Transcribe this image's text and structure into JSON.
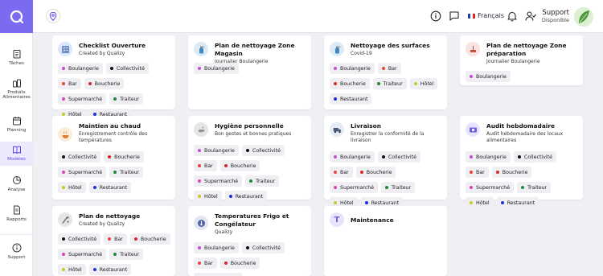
{
  "colors": {
    "accent": "#7b6bf0",
    "active_bg": "#ece9fd"
  },
  "tag_colors": {
    "Boulangerie": "#c84bd8",
    "Collectivité": "#111111",
    "Bar": "#e8453c",
    "Boucherie": "#d62828",
    "Supermarché": "#d944b8",
    "Traiteur": "#1b8a3a",
    "Hôtel": "#c7c92c",
    "Restaurant": "#1d2fd6"
  },
  "sidebar": {
    "items": [
      {
        "label": "Tâches",
        "icon": "clipboard-list-icon"
      },
      {
        "label": "Produits Alimentaires",
        "icon": "bottles-icon"
      },
      {
        "label": "Planning",
        "icon": "calendar-icon"
      },
      {
        "label": "Modèles",
        "icon": "book-icon"
      },
      {
        "label": "Analyse",
        "icon": "pie-chart-icon"
      },
      {
        "label": "Rapports",
        "icon": "document-icon"
      },
      {
        "label": "Support",
        "icon": "info-icon"
      }
    ]
  },
  "header": {
    "language": "Français",
    "support_name": "Support",
    "support_status": "Disponible"
  },
  "cards": [
    {
      "title": "Checklist Ouverture",
      "subtitle": "Created by Qualizy",
      "icon": "checklist-icon",
      "icon_bg": "#dbe7f6",
      "tags": [
        "Boulangerie",
        "Collectivité",
        "Bar",
        "Boucherie",
        "Supermarché",
        "Traiteur",
        "Hôtel",
        "Restaurant"
      ]
    },
    {
      "title": "Plan de nettoyage Zone Magasin",
      "subtitle": "Journalier Boulangerie",
      "icon": "spray-bottle-icon",
      "icon_bg": "#dbeaf5",
      "tags": [
        "Boulangerie"
      ]
    },
    {
      "title": "Nettoyage des surfaces",
      "subtitle": "Covid-19",
      "icon": "spray-bottle-icon",
      "icon_bg": "#dbeaf5",
      "tags": [
        "Boulangerie",
        "Bar",
        "Boucherie",
        "Traiteur",
        "Hôtel",
        "Restaurant"
      ]
    },
    {
      "title": "Plan de nettoyage Zone préparation",
      "subtitle": "Journalier Boulangerie",
      "icon": "cleaning-icon",
      "icon_bg": "#fbe3e3",
      "tags": [
        "Boulangerie"
      ]
    },
    {
      "title": "Maintien au chaud",
      "subtitle": "Enregistrement contrôle des températures",
      "icon": "hot-dish-icon",
      "icon_bg": "#fdecd9",
      "tags": [
        "Collectivité",
        "Boucherie",
        "Supermarché",
        "Traiteur",
        "Hôtel",
        "Restaurant"
      ]
    },
    {
      "title": "Hygiène personnelle",
      "subtitle": "Bon gestes et bonnes pratiques",
      "icon": "hand-wash-icon",
      "icon_bg": "#e6e6e6",
      "tags": [
        "Boulangerie",
        "Collectivité",
        "Bar",
        "Boucherie",
        "Supermarché",
        "Traiteur",
        "Hôtel",
        "Restaurant"
      ]
    },
    {
      "title": "Livraison",
      "subtitle": "Enregistrer la conformité de la livraison",
      "icon": "truck-icon",
      "icon_bg": "#e6ecf5",
      "tags": [
        "Boulangerie",
        "Collectivité",
        "Bar",
        "Boucherie",
        "Supermarché",
        "Traiteur",
        "Hôtel",
        "Restaurant"
      ]
    },
    {
      "title": "Audit hebdomadaire",
      "subtitle": "Audit hebdomadaire des locaux alimentaires",
      "icon": "audit-icon",
      "icon_bg": "#e7e5fb",
      "tags": [
        "Boulangerie",
        "Collectivité",
        "Bar",
        "Boucherie",
        "Supermarché",
        "Traiteur",
        "Hôtel",
        "Restaurant"
      ]
    },
    {
      "title": "Plan de nettoyage",
      "subtitle": "Created by Qualizy",
      "icon": "cleaning-tools-icon",
      "icon_bg": "#e6e6e6",
      "tags": [
        "Collectivité",
        "Bar",
        "Boucherie",
        "Supermarché",
        "Traiteur",
        "Hôtel",
        "Restaurant"
      ]
    },
    {
      "title": "Temperatures Frigo et Congélateur",
      "subtitle": "Qualizy",
      "icon": "thermometer-icon",
      "icon_bg": "#e3e7f2",
      "tags": [
        "Boulangerie",
        "Collectivité",
        "Bar",
        "Boucherie",
        "Supermarché"
      ]
    },
    {
      "title": "Maintenance",
      "subtitle": "",
      "icon": "letter-t-icon",
      "icon_bg": "#e7e5fb",
      "tags": []
    }
  ]
}
